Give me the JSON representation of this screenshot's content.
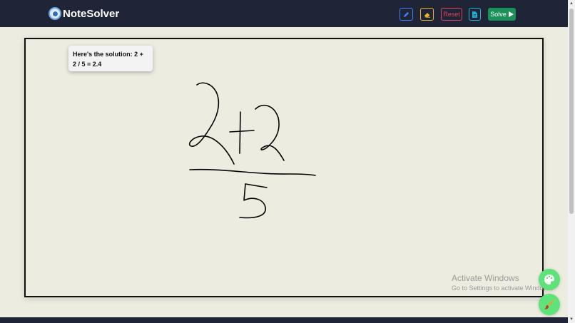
{
  "app": {
    "name": "NoteSolver",
    "logo_icon": "disc-logo-icon"
  },
  "toolbar": {
    "pen": {
      "icon": "pencil-icon",
      "color": "#3b82f6"
    },
    "eraser": {
      "icon": "eraser-icon",
      "color": "#f0b429"
    },
    "reset_label": "Reset",
    "reset_color": "#d9455a",
    "doc": {
      "icon": "document-icon",
      "color": "#1fb3d6"
    },
    "solve_label": "Solve",
    "solve_icon": "play-icon",
    "solve_color": "#1a9158"
  },
  "solution": {
    "text": "Here's the solution: 2 + 2 / 5 = 2.4"
  },
  "canvas": {
    "background": "#edece0",
    "ink_color": "#000000",
    "drawing": "handwritten fraction 2+2 over 5"
  },
  "watermark": {
    "title": "Activate Windows",
    "subtitle": "Go to Settings to activate Windows."
  },
  "floating_buttons": {
    "palette_icon": "palette-icon",
    "brush_icon": "brush-icon",
    "color": "#5ee37a"
  },
  "colors": {
    "navbar": "#1f2537",
    "page_background": "#edece0"
  }
}
